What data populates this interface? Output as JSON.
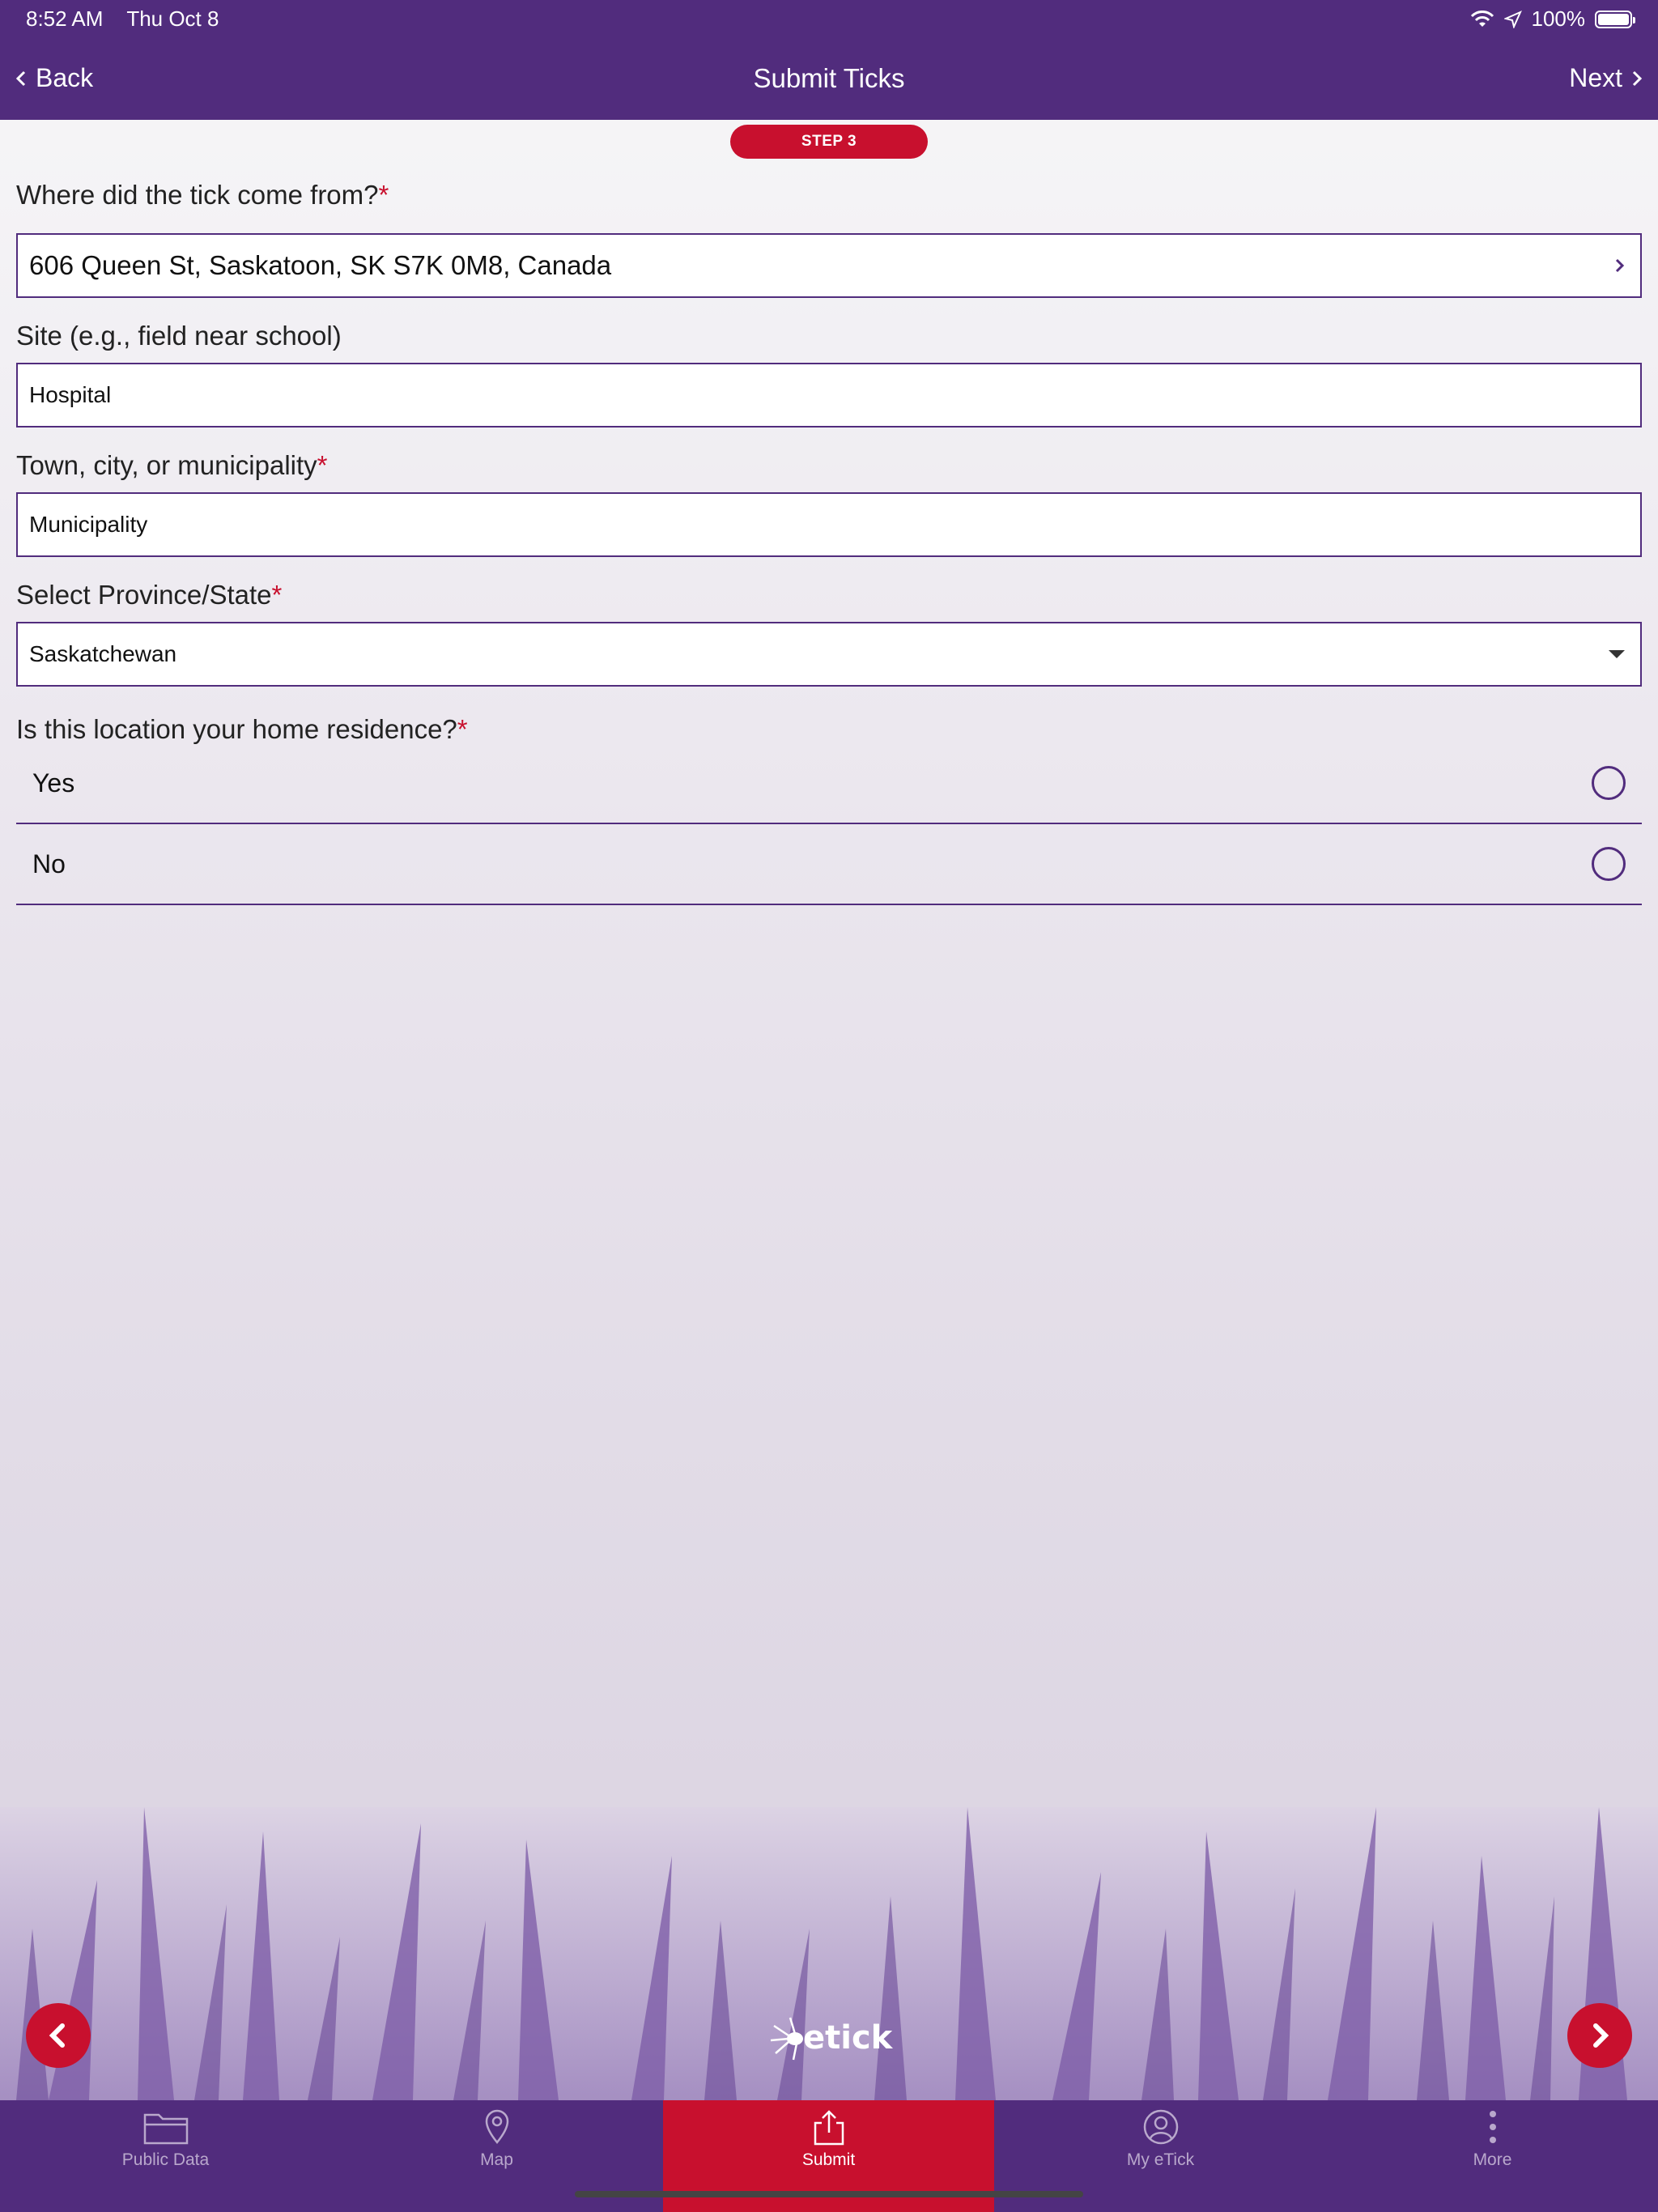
{
  "status_bar": {
    "time": "8:52 AM",
    "date": "Thu Oct 8",
    "battery": "100%",
    "icons": [
      "wifi-icon",
      "location-icon",
      "battery-icon"
    ]
  },
  "nav": {
    "back_label": "Back",
    "title": "Submit Ticks",
    "next_label": "Next"
  },
  "step": "STEP 3",
  "form": {
    "origin": {
      "label": "Where did the tick come from?",
      "required": "*",
      "value": "606 Queen St, Saskatoon, SK S7K 0M8, Canada"
    },
    "site": {
      "label": "Site (e.g., field near school)",
      "value": "Hospital"
    },
    "town": {
      "label": "Town, city, or municipality",
      "required": "*",
      "value": "Municipality"
    },
    "province": {
      "label": "Select Province/State",
      "required": "*",
      "value": "Saskatchewan"
    },
    "home_residence": {
      "label": "Is this location your home residence?",
      "required": "*",
      "options": [
        {
          "label": "Yes",
          "selected": false
        },
        {
          "label": "No",
          "selected": false
        }
      ]
    }
  },
  "logo_text": "etick",
  "tabs": [
    {
      "label": "Public Data",
      "icon": "folder-icon",
      "active": false
    },
    {
      "label": "Map",
      "icon": "map-pin-icon",
      "active": false
    },
    {
      "label": "Submit",
      "icon": "share-upload-icon",
      "active": true
    },
    {
      "label": "My eTick",
      "icon": "user-icon",
      "active": false
    },
    {
      "label": "More",
      "icon": "more-vertical-icon",
      "active": false
    }
  ],
  "colors": {
    "brand_purple": "#512c7d",
    "accent_red": "#c8102e"
  }
}
